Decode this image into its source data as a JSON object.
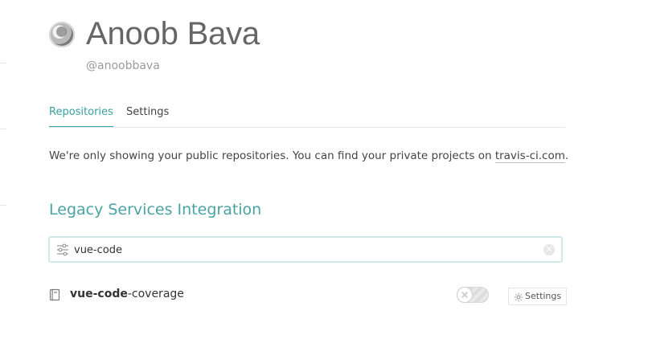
{
  "profile": {
    "name": "Anoob Bava",
    "handle": "@anoobbava"
  },
  "tabs": [
    {
      "label": "Repositories",
      "active": true
    },
    {
      "label": "Settings",
      "active": false
    }
  ],
  "notice": {
    "text_before": "We're only showing your public repositories. You can find your private projects on ",
    "link_text": "travis-ci.com",
    "text_after": "."
  },
  "section": {
    "title": "Legacy Services Integration"
  },
  "search": {
    "value": "vue-code",
    "icon": "filter-icon",
    "clear_icon": "clear-icon"
  },
  "repos": [
    {
      "name_bold": "vue-code",
      "name_rest": "-coverage",
      "enabled": false,
      "settings_label": "Settings"
    }
  ],
  "colors": {
    "accent": "#3aa3a3",
    "text": "#444444",
    "muted": "#9a9a9a"
  }
}
